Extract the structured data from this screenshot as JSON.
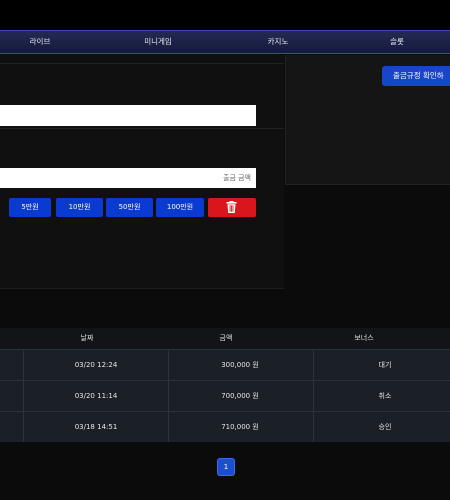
{
  "nav": {
    "items": [
      {
        "label": "라이브"
      },
      {
        "label": "미니게임"
      },
      {
        "label": "카지노"
      },
      {
        "label": "슬롯"
      }
    ]
  },
  "withdraw": {
    "amount_placeholder": "출금 금액",
    "quick_amounts": [
      {
        "label": "5만원"
      },
      {
        "label": "10만원"
      },
      {
        "label": "50만원"
      },
      {
        "label": "100만원"
      }
    ],
    "delete_icon": "trash-icon",
    "rules_button": "출금규정 확인하"
  },
  "history": {
    "headers": [
      "날짜",
      "금액",
      "보너스"
    ],
    "rows": [
      {
        "date": "03/20 12:24",
        "amount": "300,000 원",
        "status": "대기"
      },
      {
        "date": "03/20 11:14",
        "amount": "700,000 원",
        "status": "취소"
      },
      {
        "date": "03/18 14:51",
        "amount": "710,000 원",
        "status": "승인"
      }
    ]
  },
  "pagination": {
    "current": "1"
  },
  "colors": {
    "accent_blue": "#0b3ad0",
    "danger_red": "#d8161b",
    "nav_border": "#3a48c8"
  }
}
